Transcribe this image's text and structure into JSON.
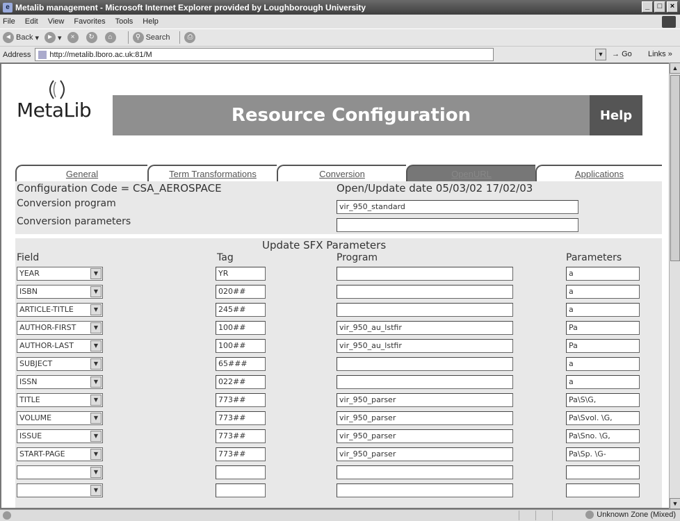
{
  "window": {
    "title": "Metalib management - Microsoft Internet Explorer provided by Loughborough University",
    "minimize": "_",
    "maximize": "□",
    "close": "×"
  },
  "menu": [
    "File",
    "Edit",
    "View",
    "Favorites",
    "Tools",
    "Help"
  ],
  "toolbar": {
    "back": "Back",
    "search": "Search"
  },
  "address": {
    "label": "Address",
    "url": "http://metalib.lboro.ac.uk:81/M",
    "go": "Go",
    "links": "Links »"
  },
  "header": {
    "logo_text": "MetaLib",
    "banner_title": "Resource Configuration",
    "help": "Help"
  },
  "tabs": [
    {
      "label": "General",
      "active": false
    },
    {
      "label": "Term Transformations",
      "active": false
    },
    {
      "label": "Conversion",
      "active": false
    },
    {
      "label": "OpenURL",
      "active": true
    },
    {
      "label": "Applications",
      "active": false
    }
  ],
  "config": {
    "code": "Configuration Code = CSA_AEROSPACE",
    "date": "Open/Update date 05/03/02 17/02/03",
    "conversion_program_label": "Conversion program",
    "conversion_program_value": "vir_950_standard",
    "conversion_parameters_label": "Conversion parameters",
    "conversion_parameters_value": ""
  },
  "sfx": {
    "title": "Update SFX Parameters",
    "columns": [
      "Field",
      "Tag",
      "Program",
      "Parameters"
    ],
    "rows": [
      {
        "field": "YEAR",
        "tag": "YR",
        "program": "",
        "params": "a"
      },
      {
        "field": "ISBN",
        "tag": "020##",
        "program": "",
        "params": "a"
      },
      {
        "field": "ARTICLE-TITLE",
        "tag": "245##",
        "program": "",
        "params": "a"
      },
      {
        "field": "AUTHOR-FIRST",
        "tag": "100##",
        "program": "vir_950_au_lstfir",
        "params": "Pa"
      },
      {
        "field": "AUTHOR-LAST",
        "tag": "100##",
        "program": "vir_950_au_lstfir",
        "params": "Pa"
      },
      {
        "field": "SUBJECT",
        "tag": "65###",
        "program": "",
        "params": "a"
      },
      {
        "field": "ISSN",
        "tag": "022##",
        "program": "",
        "params": "a"
      },
      {
        "field": "TITLE",
        "tag": "773##",
        "program": "vir_950_parser",
        "params": "Pa\\S\\G,"
      },
      {
        "field": "VOLUME",
        "tag": "773##",
        "program": "vir_950_parser",
        "params": "Pa\\Svol. \\G,"
      },
      {
        "field": "ISSUE",
        "tag": "773##",
        "program": "vir_950_parser",
        "params": "Pa\\Sno. \\G,"
      },
      {
        "field": "START-PAGE",
        "tag": "773##",
        "program": "vir_950_parser",
        "params": "Pa\\Sp. \\G-"
      },
      {
        "field": "",
        "tag": "",
        "program": "",
        "params": ""
      },
      {
        "field": "",
        "tag": "",
        "program": "",
        "params": ""
      }
    ]
  },
  "status": {
    "zone": "Unknown Zone (Mixed)"
  }
}
